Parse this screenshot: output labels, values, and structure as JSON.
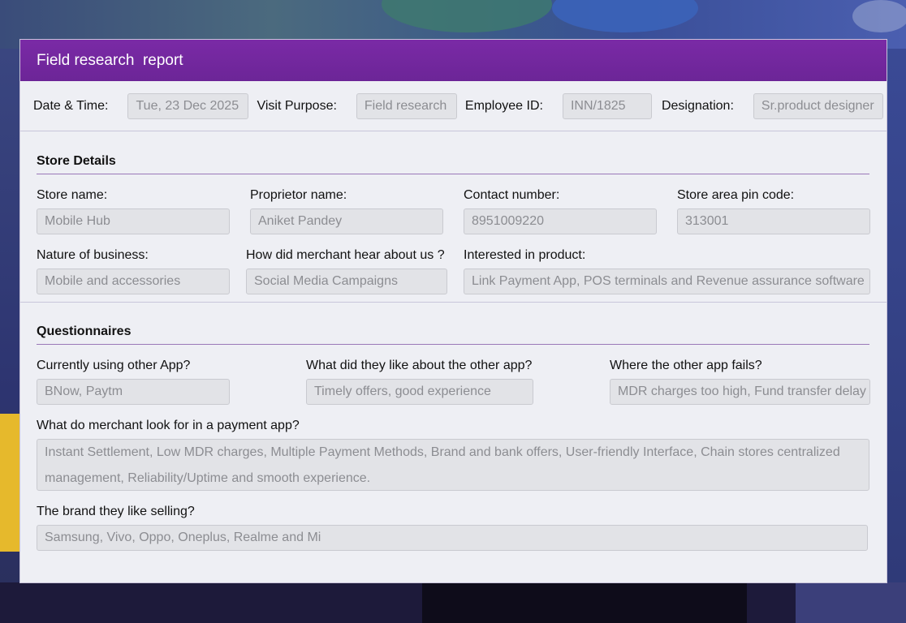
{
  "header": {
    "title": "Field research  report"
  },
  "topbar": {
    "date_label": "Date & Time:",
    "date_value": "Tue, 23 Dec 2025",
    "purpose_label": "Visit Purpose:",
    "purpose_value": "Field research",
    "employee_label": "Employee ID:",
    "employee_value": "INN/1825",
    "designation_label": "Designation:",
    "designation_value": "Sr.product designer"
  },
  "store": {
    "title": "Store Details",
    "store_name_label": "Store name:",
    "store_name_value": "Mobile Hub",
    "proprietor_label": "Proprietor name:",
    "proprietor_value": "Aniket Pandey",
    "contact_label": "Contact number:",
    "contact_value": "8951009220",
    "pin_label": "Store area pin code:",
    "pin_value": "313001",
    "nature_label": "Nature of business:",
    "nature_value": "Mobile and accessories",
    "hear_label": "How did merchant hear about us ?",
    "hear_value": "Social Media Campaigns",
    "interest_label": "Interested in product:",
    "interest_value": "Link Payment App, POS terminals and Revenue assurance software"
  },
  "questions": {
    "title": "Questionnaires",
    "other_app_label": "Currently using other App?",
    "other_app_value": "BNow, Paytm",
    "like_label": "What did they like about the other app?",
    "like_value": "Timely offers, good experience",
    "fails_label": "Where the other app fails?",
    "fails_value": "MDR charges too high, Fund transfer delay",
    "lookfor_label": "What do merchant look for in a payment app?",
    "lookfor_value": "Instant Settlement, Low MDR charges, Multiple Payment Methods, Brand and bank offers, User-friendly Interface, Chain stores centralized management, Reliability/Uptime and smooth experience.",
    "brand_label": "The brand they like selling?",
    "brand_value": "Samsung, Vivo, Oppo, Oneplus, Realme and Mi"
  }
}
